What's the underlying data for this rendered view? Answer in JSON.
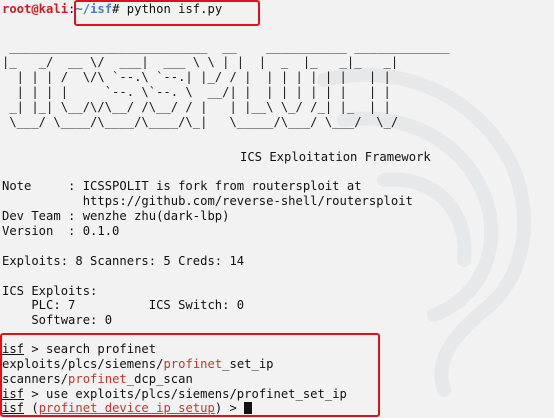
{
  "prompt": {
    "user": "root@kali",
    "sep": ":",
    "path": "~/isf",
    "hash": "# ",
    "command": "python isf.py"
  },
  "banner": [
    " ___________________________  __    ___________ _____________",
    "|_   _/  __ \\/  ___|  ___ \\ \\ | |  |  _  |_   _|_   _|",
    "  | | | /  \\/\\ `--.\\ `--.| |_/ / |  | | | | | |   | |  ",
    "  | | | |     `--. \\`--. \\  __/| |  | | | | | |   | |  ",
    " _| |_| \\__/\\/\\__/ /\\__/ / |   | |__\\ \\_/ /_| |_  | |  ",
    " \\___/ \\____/\\____/\\____/\\_|   \\_____/\\___/ \\___/  \\_/  "
  ],
  "subtitle": "ICS Exploitation Framework",
  "info": [
    "Note     : ICSSPOLIT is fork from routersploit at",
    "           https://github.com/reverse-shell/routersploit",
    "Dev Team : wenzhe zhu(dark-lbp)",
    "Version  : 0.1.0"
  ],
  "counts": "Exploits: 8 Scanners: 5 Creds: 14",
  "ics_header": "ICS Exploits:",
  "plc": "    PLC: 7          ICS Switch: 0",
  "software": "    Software: 0",
  "session": {
    "isf": "isf",
    "cmd1": " > search profinet",
    "result1_prefix": "exploits/plcs/siemens/",
    "result1_match": "profinet",
    "result1_suffix": "_set_ip",
    "result2_prefix": "scanners/",
    "result2_match": "profinet",
    "result2_suffix": "_dcp_scan",
    "cmd2": " > use exploits/plcs/siemens/profinet_set_ip",
    "module_open": " (",
    "module": "profinet device ip setup",
    "module_close": ") > "
  }
}
